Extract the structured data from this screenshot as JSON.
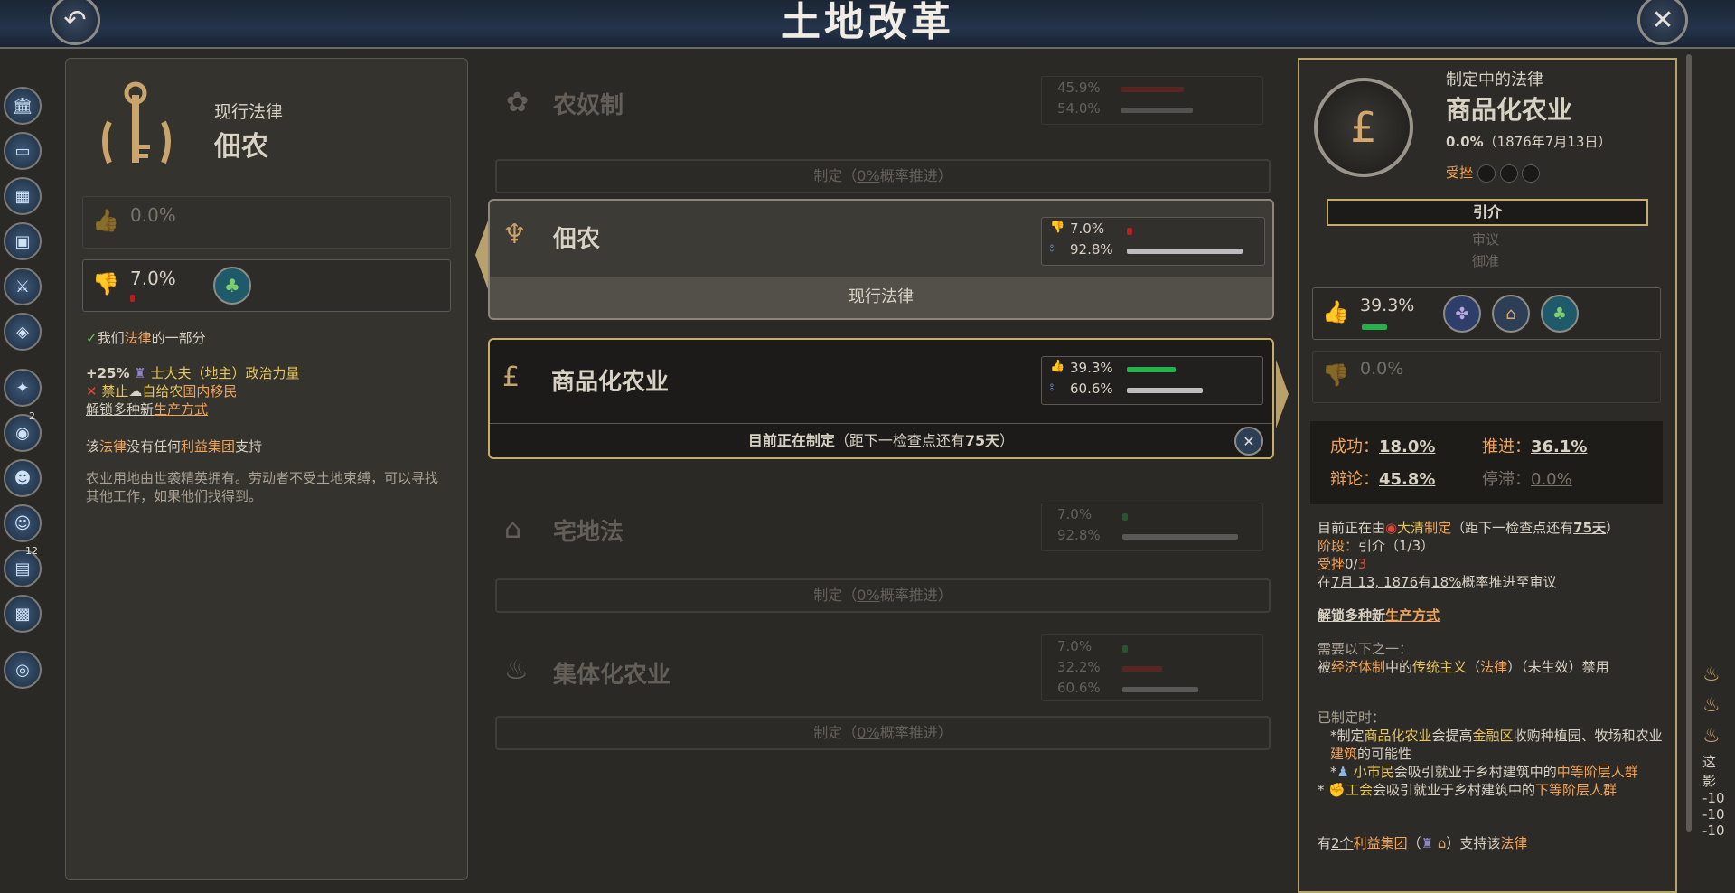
{
  "window": {
    "title": "土地改革"
  },
  "rail": {
    "badges": [
      "2",
      "12"
    ]
  },
  "left": {
    "header_label": "现行法律",
    "law_name": "佃农",
    "support_pct": "0.0%",
    "oppose_pct": "7.0%",
    "line_part": "我们",
    "line_part_law": "法律",
    "line_part_end": "的一部分",
    "effect1_prefix": "+25%",
    "effect1_group": "士大夫（地主）",
    "effect1_suffix": "政治力量",
    "effect2_prefix": "禁止",
    "effect2_mid": "自给农",
    "effect2_suffix": "国内移民",
    "effect3_prefix": "解锁多种新",
    "effect3_link": "生产方式",
    "nosupport_a": "该",
    "nosupport_law": "法律",
    "nosupport_b": "没有任何",
    "nosupport_ig": "利益集团",
    "nosupport_c": "支持",
    "desc": "农业用地由世袭精英拥有。劳动者不受土地束缚，可以寻找其他工作，如果他们找得到。"
  },
  "laws": {
    "serfdom": {
      "name": "农奴制",
      "pct1": "45.9%",
      "pct2": "54.0%",
      "enact": "制定（",
      "enact_pct": "0%",
      "enact_end": "概率推进）"
    },
    "tenant": {
      "name": "佃农",
      "pct1": "7.0%",
      "pct2": "92.8%",
      "status": "现行法律"
    },
    "commercial": {
      "name": "商品化农业",
      "pct1": "39.3%",
      "pct2": "60.6%",
      "status_a": "目前正在制定",
      "status_b": "（距下一检查点还有",
      "status_days": "75天",
      "status_c": "）"
    },
    "homestead": {
      "name": "宅地法",
      "pct1": "7.0%",
      "pct2": "92.8%",
      "enact": "制定（",
      "enact_pct": "0%",
      "enact_end": "概率推进）"
    },
    "collective": {
      "name": "集体化农业",
      "pct1": "7.0%",
      "pct2": "32.2%",
      "pct3": "60.6%",
      "enact": "制定（",
      "enact_pct": "0%",
      "enact_end": "概率推进）"
    }
  },
  "right": {
    "header_label": "制定中的法律",
    "law_name": "商品化农业",
    "pct": "0.0%",
    "date": "（1876年7月13日）",
    "setback_label": "受挫",
    "stage_active": "引介",
    "stage2": "审议",
    "stage3": "御准",
    "support_pct": "39.3%",
    "oppose_pct": "0.0%",
    "success_label": "成功：",
    "success_val": "18.0%",
    "advance_label": "推进：",
    "advance_val": "36.1%",
    "debate_label": "辩论：",
    "debate_val": "45.8%",
    "stall_label": "停滞：",
    "stall_val": "0.0%",
    "line1_a": "目前正在由",
    "line1_country": "大清",
    "line1_b": "制定",
    "line1_c": "（距下一检查点还有",
    "line1_days": "75天",
    "line1_d": "）",
    "stage_label": "阶段：",
    "stage_val": "引介（1/3）",
    "setback_line_a": "受挫",
    "setback_line_b": "0/",
    "setback_line_c": "3",
    "chance_a": "在",
    "chance_date": "7月 13, 1876",
    "chance_b": "有",
    "chance_pct": "18%",
    "chance_c": "概率推进至审议",
    "unlock_a": "解锁多种新",
    "unlock_link": "生产方式",
    "req_title": "需要以下之一：",
    "req_a": "被",
    "req_econ": "经济体制",
    "req_b": "中的",
    "req_trad": "传统主义",
    "req_c": "（",
    "req_law": "法律",
    "req_d": "）（未生效）禁用",
    "enacted_title": "已制定时：",
    "en1_a": "*制定",
    "en1_law": "商品化农业",
    "en1_b": "会提高",
    "en1_fin": "金融区",
    "en1_c": "收购种植园、牧场和农业",
    "en1_bld": "建筑",
    "en1_d": "的可能性",
    "en2_a": "*",
    "en2_grp": "小市民",
    "en2_b": "会吸引就业于乡村建筑中的",
    "en2_c": "中等阶层人群",
    "en3_a": "*",
    "en3_grp": "工会",
    "en3_b": "会吸引就业于乡村建筑中的",
    "en3_c": "下等阶层人群",
    "ig_a": "有",
    "ig_n": "2个",
    "ig_b": "利益集团",
    "ig_c": "（",
    "ig_d": "）支持该",
    "ig_law": "法律"
  },
  "edge": {
    "text1": "这",
    "text2": "影",
    "vals": [
      "-10",
      "-10",
      "-10"
    ]
  },
  "colors": {
    "accent_gold": "#b8a16a",
    "approve_green": "#22b34a",
    "oppose_red": "#b81f1f"
  }
}
